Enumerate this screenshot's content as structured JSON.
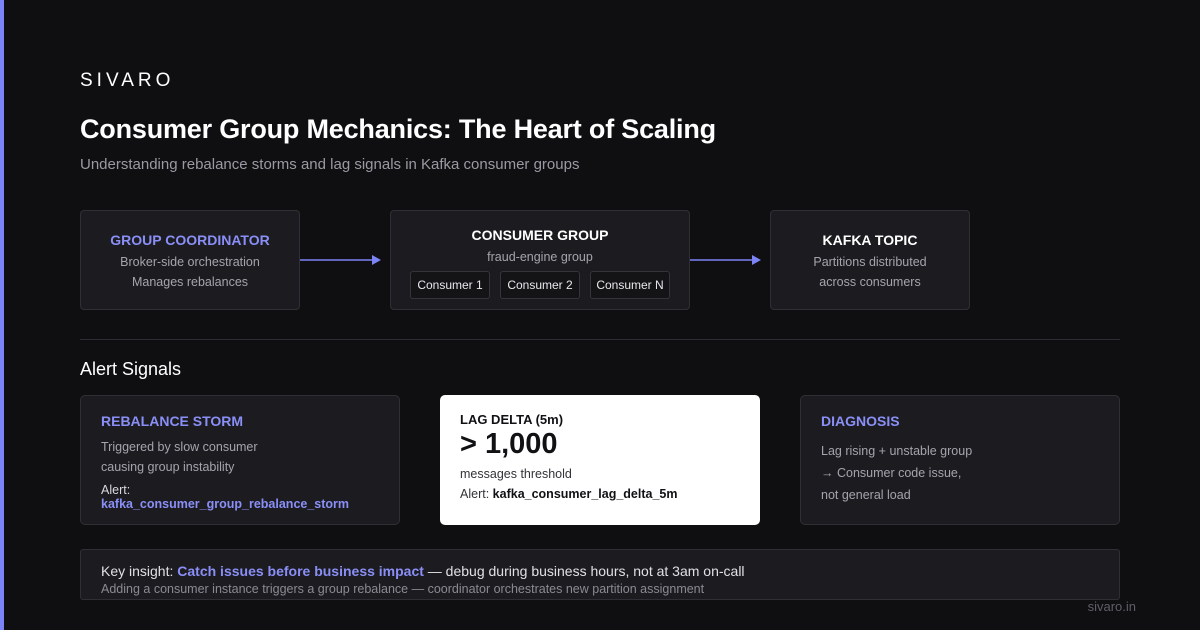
{
  "brand": "SIVARO",
  "title": "Consumer Group Mechanics: The Heart of Scaling",
  "subtitle": "Understanding rebalance storms and lag signals in Kafka consumer groups",
  "diagram": {
    "coordinator": {
      "title": "GROUP COORDINATOR",
      "lines": [
        "Broker-side orchestration",
        "Manages rebalances"
      ]
    },
    "consumer_group": {
      "title": "CONSUMER GROUP",
      "subtitle": "fraud-engine group",
      "consumers": [
        "Consumer 1",
        "Consumer 2",
        "Consumer N"
      ]
    },
    "topic": {
      "title": "KAFKA TOPIC",
      "lines": [
        "Partitions distributed",
        "across consumers"
      ]
    }
  },
  "alerts": {
    "section_title": "Alert Signals",
    "storm": {
      "title": "REBALANCE STORM",
      "lines": [
        "Triggered by slow consumer",
        "causing group instability"
      ],
      "alert_prefix": "Alert:",
      "metric": "kafka_consumer_group_rebalance_storm"
    },
    "lag": {
      "title": "LAG DELTA (5m)",
      "value": "> 1,000",
      "caption": "messages threshold",
      "alert_prefix": "Alert:",
      "metric": "kafka_consumer_lag_delta_5m"
    },
    "diagnosis": {
      "title": "DIAGNOSIS",
      "lines": [
        "Lag rising + unstable group",
        "→ Consumer code issue,",
        "not general load"
      ]
    }
  },
  "insight": {
    "prefix": "Key insight:",
    "highlight": "Catch issues before business impact",
    "rest": "— debug during business hours, not at 3am on-call",
    "sub": "Adding a consumer instance triggers a group rebalance — coordinator orchestrates new partition assignment"
  },
  "footer": "sivaro.in",
  "colors": {
    "accent": "#7c84f5",
    "background": "#0f0f11",
    "card": "#1c1c20"
  }
}
